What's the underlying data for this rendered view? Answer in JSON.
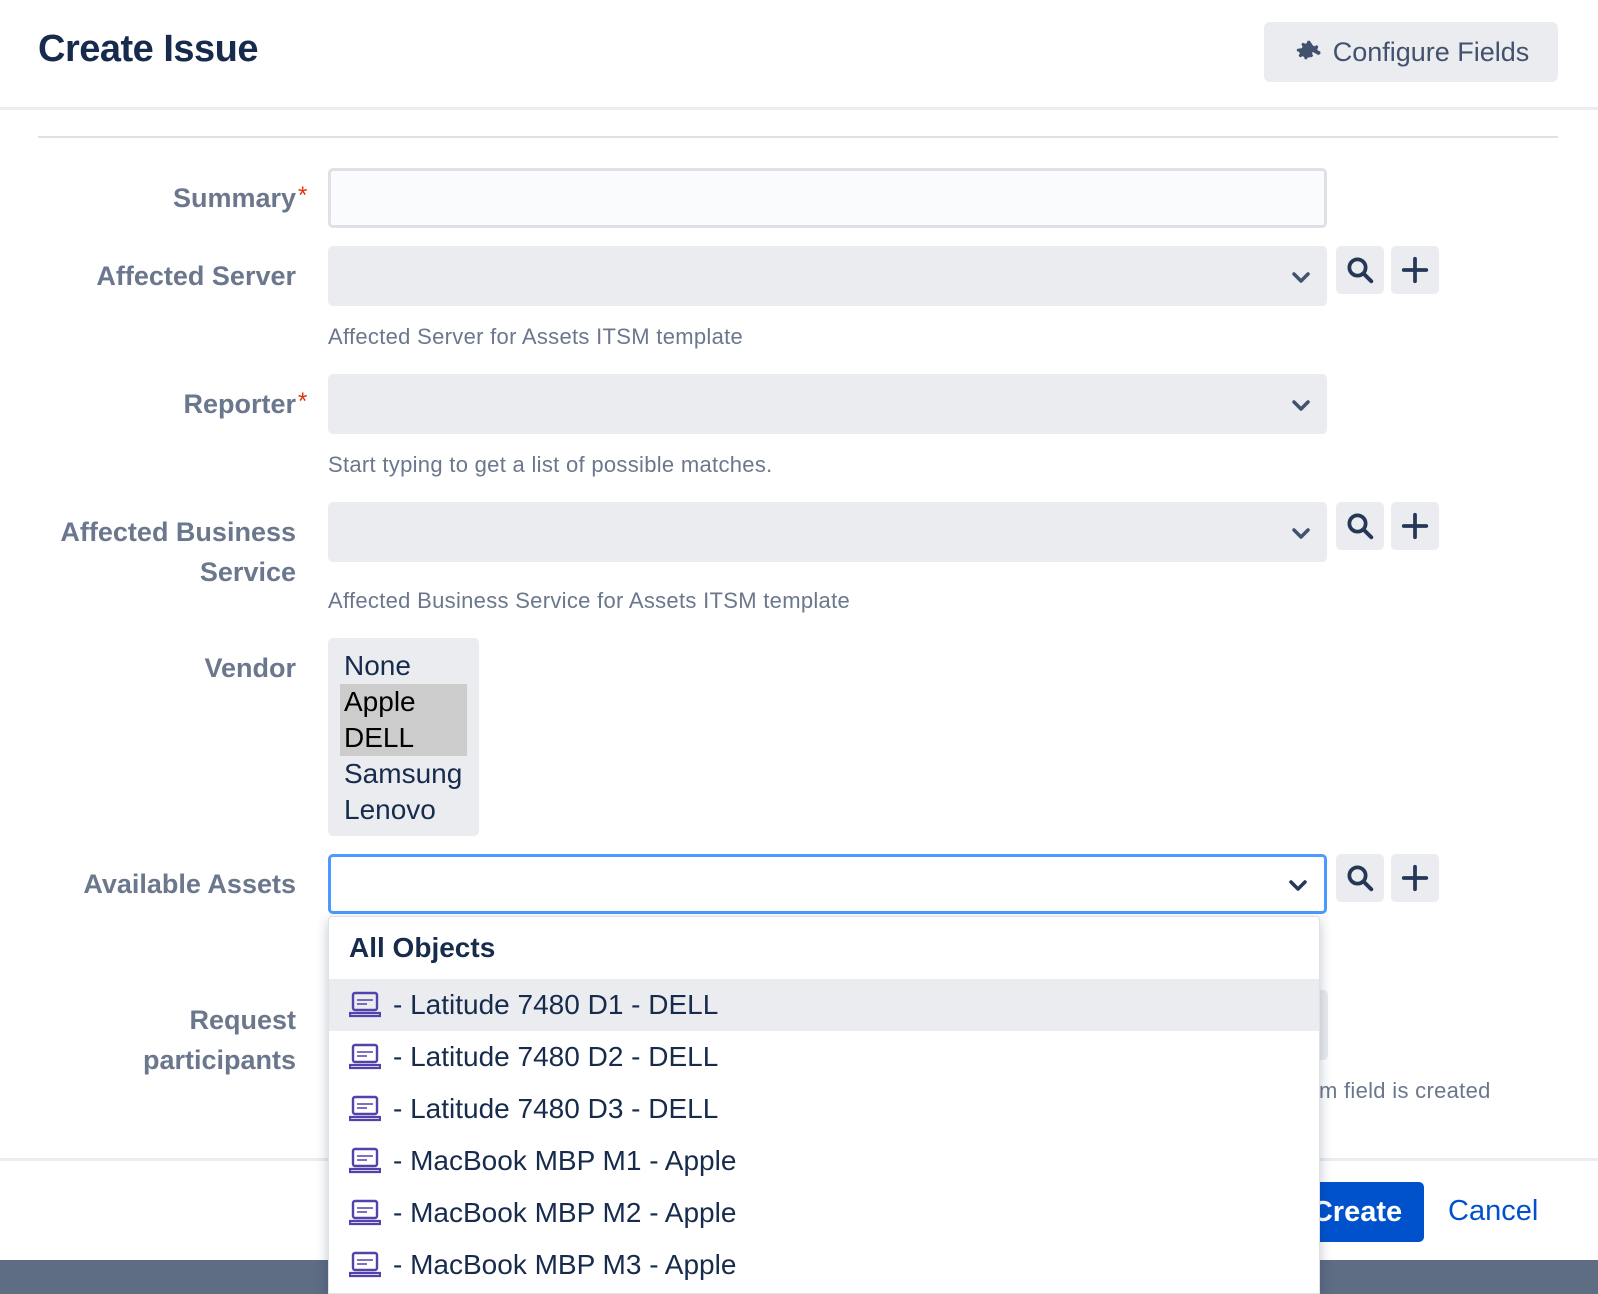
{
  "dialog": {
    "title": "Create Issue",
    "configure_label": "Configure Fields"
  },
  "fields": {
    "summary": {
      "label": "Summary",
      "required_mark": "*",
      "value": ""
    },
    "affected_server": {
      "label": "Affected Server",
      "helper": "Affected Server for Assets ITSM template",
      "value": ""
    },
    "reporter": {
      "label": "Reporter",
      "required_mark": "*",
      "helper": "Start typing to get a list of possible matches.",
      "value": ""
    },
    "affected_business_service": {
      "label_line1": "Affected Business",
      "label_line2": "Service",
      "helper": "Affected Business Service for Assets ITSM template",
      "value": ""
    },
    "vendor": {
      "label": "Vendor",
      "options": [
        {
          "label": "None",
          "selected": false
        },
        {
          "label": "Apple",
          "selected": true
        },
        {
          "label": "DELL",
          "selected": true
        },
        {
          "label": "Samsung",
          "selected": false
        },
        {
          "label": "Lenovo",
          "selected": false
        }
      ]
    },
    "available_assets": {
      "label": "Available Assets",
      "value": ""
    },
    "request_participants": {
      "label_line1": "Request",
      "label_line2": "participants",
      "helper_partial": "tom field is created"
    }
  },
  "dropdown": {
    "header": "All Objects",
    "items": [
      {
        "label": "- Latitude 7480 D1 - DELL",
        "icon": "laptop-icon",
        "hovered": true
      },
      {
        "label": "- Latitude 7480 D2 - DELL",
        "icon": "laptop-icon",
        "hovered": false
      },
      {
        "label": "- Latitude 7480 D3 - DELL",
        "icon": "laptop-icon",
        "hovered": false
      },
      {
        "label": "- MacBook MBP M1 - Apple",
        "icon": "laptop-icon",
        "hovered": false
      },
      {
        "label": "- MacBook MBP M2 - Apple",
        "icon": "laptop-icon",
        "hovered": false
      },
      {
        "label": "- MacBook MBP M3 - Apple",
        "icon": "laptop-icon",
        "hovered": false
      }
    ]
  },
  "footer": {
    "create_label": "Create",
    "cancel_label": "Cancel"
  },
  "colors": {
    "primary": "#0052cc",
    "focus_border": "#4c9aff",
    "required": "#de350b",
    "field_bg": "#ebecf0",
    "icon_accent": "#5243aa"
  }
}
